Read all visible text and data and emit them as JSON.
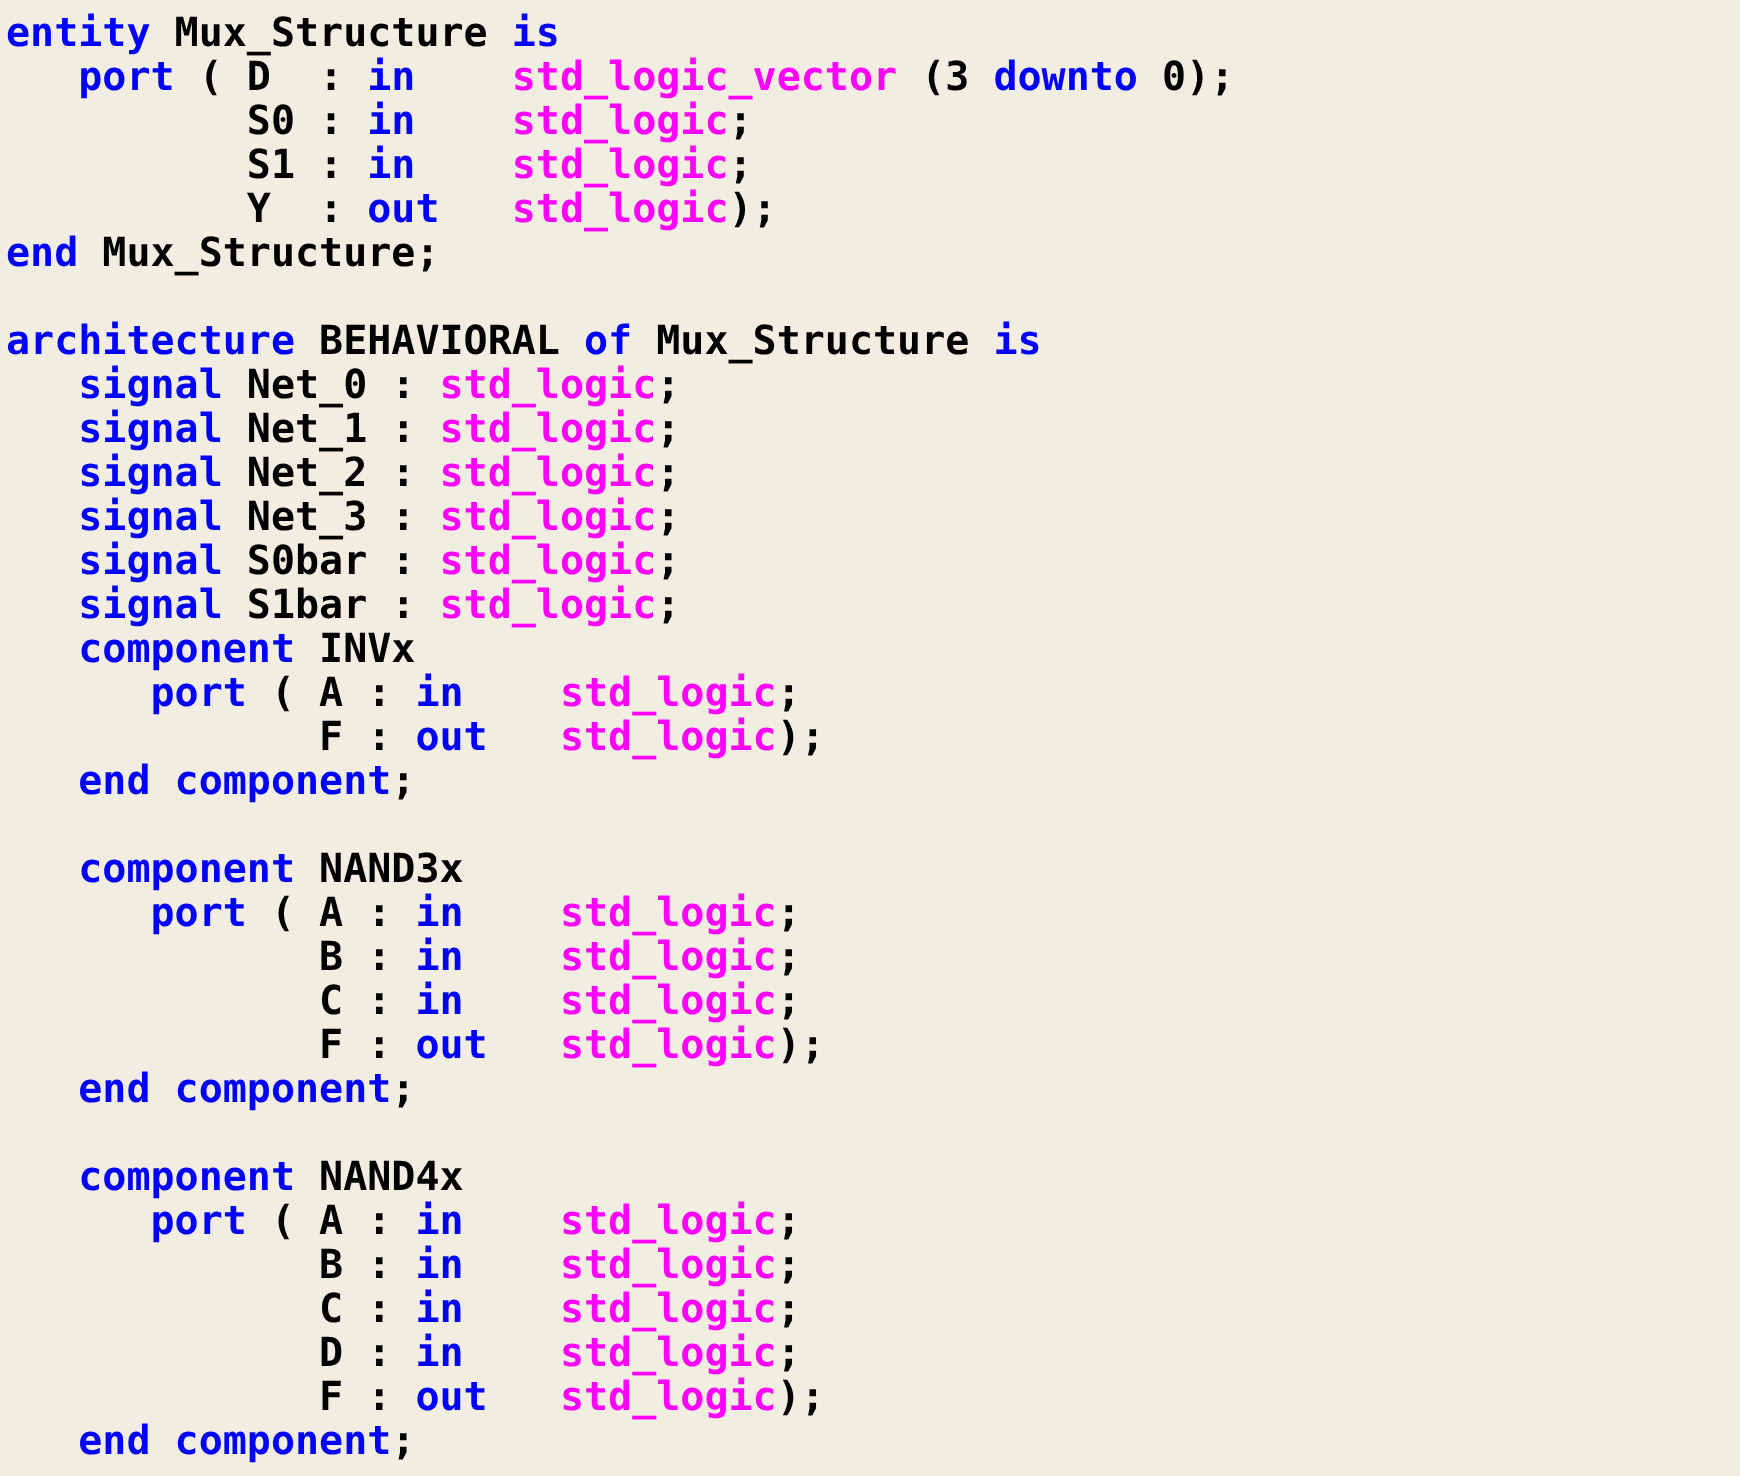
{
  "editor": {
    "blocks": [
      {
        "lines": [
          {
            "tokens": [
              {
                "text": "entity",
                "kind": "keyword"
              },
              {
                "text": " Mux_Structure ",
                "kind": "plain"
              },
              {
                "text": "is",
                "kind": "keyword"
              }
            ]
          },
          {
            "tokens": [
              {
                "text": "   port",
                "kind": "keyword"
              },
              {
                "text": " ( D  : ",
                "kind": "plain"
              },
              {
                "text": "in    ",
                "kind": "keyword"
              },
              {
                "text": "std_logic_vector",
                "kind": "type"
              },
              {
                "text": " (3 ",
                "kind": "plain"
              },
              {
                "text": "downto",
                "kind": "keyword"
              },
              {
                "text": " 0);",
                "kind": "plain"
              }
            ]
          },
          {
            "tokens": [
              {
                "text": "          S0 : ",
                "kind": "plain"
              },
              {
                "text": "in    ",
                "kind": "keyword"
              },
              {
                "text": "std_logic",
                "kind": "type"
              },
              {
                "text": ";",
                "kind": "plain"
              }
            ]
          },
          {
            "tokens": [
              {
                "text": "          S1 : ",
                "kind": "plain"
              },
              {
                "text": "in    ",
                "kind": "keyword"
              },
              {
                "text": "std_logic",
                "kind": "type"
              },
              {
                "text": ";",
                "kind": "plain"
              }
            ]
          },
          {
            "tokens": [
              {
                "text": "          Y  : ",
                "kind": "plain"
              },
              {
                "text": "out   ",
                "kind": "keyword"
              },
              {
                "text": "std_logic",
                "kind": "type"
              },
              {
                "text": ");",
                "kind": "plain"
              }
            ]
          },
          {
            "tokens": [
              {
                "text": "end",
                "kind": "keyword"
              },
              {
                "text": " Mux_Structure;",
                "kind": "plain"
              }
            ]
          }
        ]
      },
      {
        "lines": [
          {
            "tokens": [
              {
                "text": "architecture",
                "kind": "keyword"
              },
              {
                "text": " BEHAVIORAL ",
                "kind": "plain"
              },
              {
                "text": "of",
                "kind": "keyword"
              },
              {
                "text": " Mux_Structure ",
                "kind": "plain"
              },
              {
                "text": "is",
                "kind": "keyword"
              }
            ]
          },
          {
            "tokens": [
              {
                "text": "   signal",
                "kind": "keyword"
              },
              {
                "text": " Net_0 : ",
                "kind": "plain"
              },
              {
                "text": "std_logic",
                "kind": "type"
              },
              {
                "text": ";",
                "kind": "plain"
              }
            ]
          },
          {
            "tokens": [
              {
                "text": "   signal",
                "kind": "keyword"
              },
              {
                "text": " Net_1 : ",
                "kind": "plain"
              },
              {
                "text": "std_logic",
                "kind": "type"
              },
              {
                "text": ";",
                "kind": "plain"
              }
            ]
          },
          {
            "tokens": [
              {
                "text": "   signal",
                "kind": "keyword"
              },
              {
                "text": " Net_2 : ",
                "kind": "plain"
              },
              {
                "text": "std_logic",
                "kind": "type"
              },
              {
                "text": ";",
                "kind": "plain"
              }
            ]
          },
          {
            "tokens": [
              {
                "text": "   signal",
                "kind": "keyword"
              },
              {
                "text": " Net_3 : ",
                "kind": "plain"
              },
              {
                "text": "std_logic",
                "kind": "type"
              },
              {
                "text": ";",
                "kind": "plain"
              }
            ]
          },
          {
            "tokens": [
              {
                "text": "   signal",
                "kind": "keyword"
              },
              {
                "text": " S0bar : ",
                "kind": "plain"
              },
              {
                "text": "std_logic",
                "kind": "type"
              },
              {
                "text": ";",
                "kind": "plain"
              }
            ]
          },
          {
            "tokens": [
              {
                "text": "   signal",
                "kind": "keyword"
              },
              {
                "text": " S1bar : ",
                "kind": "plain"
              },
              {
                "text": "std_logic",
                "kind": "type"
              },
              {
                "text": ";",
                "kind": "plain"
              }
            ]
          },
          {
            "tokens": [
              {
                "text": "   component",
                "kind": "keyword"
              },
              {
                "text": " INVx",
                "kind": "plain"
              }
            ]
          },
          {
            "tokens": [
              {
                "text": "      port",
                "kind": "keyword"
              },
              {
                "text": " ( A : ",
                "kind": "plain"
              },
              {
                "text": "in    ",
                "kind": "keyword"
              },
              {
                "text": "std_logic",
                "kind": "type"
              },
              {
                "text": ";",
                "kind": "plain"
              }
            ]
          },
          {
            "tokens": [
              {
                "text": "             F : ",
                "kind": "plain"
              },
              {
                "text": "out   ",
                "kind": "keyword"
              },
              {
                "text": "std_logic",
                "kind": "type"
              },
              {
                "text": ");",
                "kind": "plain"
              }
            ]
          },
          {
            "tokens": [
              {
                "text": "   end component",
                "kind": "keyword"
              },
              {
                "text": ";",
                "kind": "plain"
              }
            ]
          }
        ]
      },
      {
        "lines": [
          {
            "tokens": [
              {
                "text": "   component",
                "kind": "keyword"
              },
              {
                "text": " NAND3x",
                "kind": "plain"
              }
            ]
          },
          {
            "tokens": [
              {
                "text": "      port",
                "kind": "keyword"
              },
              {
                "text": " ( A : ",
                "kind": "plain"
              },
              {
                "text": "in    ",
                "kind": "keyword"
              },
              {
                "text": "std_logic",
                "kind": "type"
              },
              {
                "text": ";",
                "kind": "plain"
              }
            ]
          },
          {
            "tokens": [
              {
                "text": "             B : ",
                "kind": "plain"
              },
              {
                "text": "in    ",
                "kind": "keyword"
              },
              {
                "text": "std_logic",
                "kind": "type"
              },
              {
                "text": ";",
                "kind": "plain"
              }
            ]
          },
          {
            "tokens": [
              {
                "text": "             C : ",
                "kind": "plain"
              },
              {
                "text": "in    ",
                "kind": "keyword"
              },
              {
                "text": "std_logic",
                "kind": "type"
              },
              {
                "text": ";",
                "kind": "plain"
              }
            ]
          },
          {
            "tokens": [
              {
                "text": "             F : ",
                "kind": "plain"
              },
              {
                "text": "out   ",
                "kind": "keyword"
              },
              {
                "text": "std_logic",
                "kind": "type"
              },
              {
                "text": ");",
                "kind": "plain"
              }
            ]
          },
          {
            "tokens": [
              {
                "text": "   end component",
                "kind": "keyword"
              },
              {
                "text": ";",
                "kind": "plain"
              }
            ]
          }
        ]
      },
      {
        "lines": [
          {
            "tokens": [
              {
                "text": "   component",
                "kind": "keyword"
              },
              {
                "text": " NAND4x",
                "kind": "plain"
              }
            ]
          },
          {
            "tokens": [
              {
                "text": "      port",
                "kind": "keyword"
              },
              {
                "text": " ( A : ",
                "kind": "plain"
              },
              {
                "text": "in    ",
                "kind": "keyword"
              },
              {
                "text": "std_logic",
                "kind": "type"
              },
              {
                "text": ";",
                "kind": "plain"
              }
            ]
          },
          {
            "tokens": [
              {
                "text": "             B : ",
                "kind": "plain"
              },
              {
                "text": "in    ",
                "kind": "keyword"
              },
              {
                "text": "std_logic",
                "kind": "type"
              },
              {
                "text": ";",
                "kind": "plain"
              }
            ]
          },
          {
            "tokens": [
              {
                "text": "             C : ",
                "kind": "plain"
              },
              {
                "text": "in    ",
                "kind": "keyword"
              },
              {
                "text": "std_logic",
                "kind": "type"
              },
              {
                "text": ";",
                "kind": "plain"
              }
            ]
          },
          {
            "tokens": [
              {
                "text": "             D : ",
                "kind": "plain"
              },
              {
                "text": "in    ",
                "kind": "keyword"
              },
              {
                "text": "std_logic",
                "kind": "type"
              },
              {
                "text": ";",
                "kind": "plain"
              }
            ]
          },
          {
            "tokens": [
              {
                "text": "             F : ",
                "kind": "plain"
              },
              {
                "text": "out   ",
                "kind": "keyword"
              },
              {
                "text": "std_logic",
                "kind": "type"
              },
              {
                "text": ");",
                "kind": "plain"
              }
            ]
          },
          {
            "tokens": [
              {
                "text": "   end component",
                "kind": "keyword"
              },
              {
                "text": ";",
                "kind": "plain"
              }
            ]
          }
        ]
      }
    ]
  }
}
